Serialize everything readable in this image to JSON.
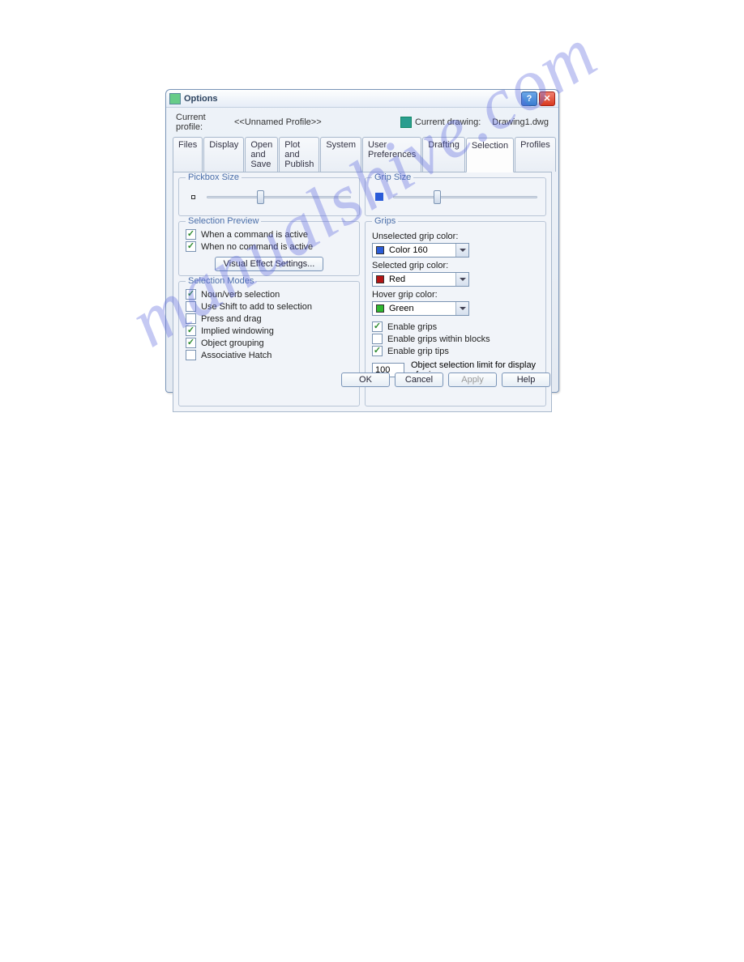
{
  "window": {
    "title": "Options"
  },
  "profile": {
    "label": "Current profile:",
    "name": "<<Unnamed Profile>>",
    "drawing_label": "Current drawing:",
    "drawing_name": "Drawing1.dwg"
  },
  "tabs": [
    "Files",
    "Display",
    "Open and Save",
    "Plot and Publish",
    "System",
    "User Preferences",
    "Drafting",
    "Selection",
    "Profiles"
  ],
  "active_tab": "Selection",
  "left": {
    "pickbox": {
      "legend": "Pickbox Size"
    },
    "preview": {
      "legend": "Selection Preview",
      "cmd_active": "When a command is active",
      "no_cmd_active": "When no command is active",
      "button": "Visual Effect Settings..."
    },
    "modes": {
      "legend": "Selection Modes",
      "noun_verb": "Noun/verb selection",
      "use_shift": "Use Shift to add to selection",
      "press_drag": "Press and drag",
      "implied": "Implied windowing",
      "grouping": "Object grouping",
      "hatch": "Associative Hatch"
    }
  },
  "right": {
    "gripsize": {
      "legend": "Grip Size"
    },
    "grips": {
      "legend": "Grips",
      "unselected_label": "Unselected grip color:",
      "unselected_value": "Color 160",
      "selected_label": "Selected grip color:",
      "selected_value": "Red",
      "hover_label": "Hover grip color:",
      "hover_value": "Green",
      "enable_grips": "Enable grips",
      "enable_blocks": "Enable grips within blocks",
      "enable_tips": "Enable grip tips",
      "limit_value": "100",
      "limit_label": "Object selection limit for display of grips"
    }
  },
  "footer": {
    "ok": "OK",
    "cancel": "Cancel",
    "apply": "Apply",
    "help": "Help"
  },
  "watermark": "manualshive.com",
  "colors": {
    "unselected": "#2b5cd8",
    "selected": "#b41414",
    "hover": "#2fb82f"
  }
}
